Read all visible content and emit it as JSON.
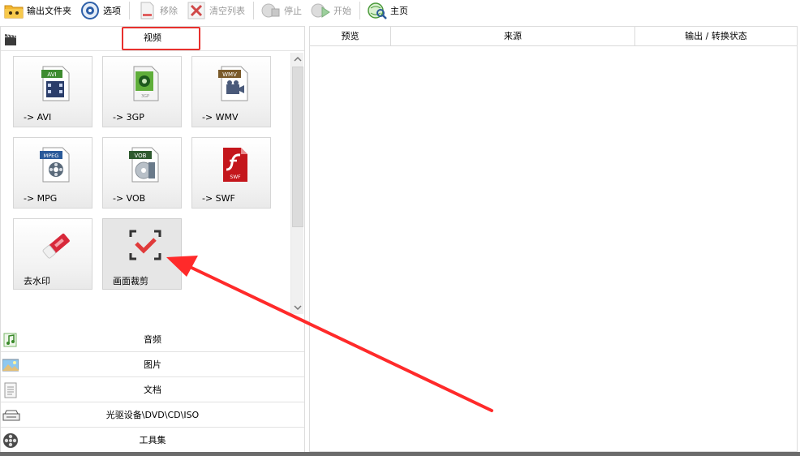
{
  "toolbar": {
    "output_folder": "输出文件夹",
    "options": "选项",
    "remove": "移除",
    "clear_list": "清空列表",
    "stop": "停止",
    "start": "开始",
    "home": "主页"
  },
  "categories": {
    "video": "视频",
    "audio": "音频",
    "image": "图片",
    "document": "文档",
    "disc": "光驱设备\\DVD\\CD\\ISO",
    "tools": "工具集"
  },
  "video_tiles": [
    {
      "label": "-> AVI",
      "badge": "AVI",
      "icon": "avi-file-icon"
    },
    {
      "label": "-> 3GP",
      "badge": "3GP",
      "icon": "3gp-file-icon"
    },
    {
      "label": "-> WMV",
      "badge": "WMV",
      "icon": "wmv-file-icon"
    },
    {
      "label": "-> MPG",
      "badge": "MPEG",
      "icon": "mpeg-file-icon"
    },
    {
      "label": "-> VOB",
      "badge": "VOB",
      "icon": "vob-file-icon"
    },
    {
      "label": "-> SWF",
      "badge": "SWF",
      "icon": "swf-file-icon"
    },
    {
      "label": "去水印",
      "icon": "eraser-icon"
    },
    {
      "label": "画面裁剪",
      "icon": "crop-check-icon"
    }
  ],
  "columns": {
    "preview": "预览",
    "source": "来源",
    "output_status": "输出 / 转换状态"
  },
  "colors": {
    "highlight_red": "#e8302d",
    "avi_green": "#3d8b2f",
    "wmv_brown": "#7a5a2a",
    "mpeg_blue": "#2a5a9a",
    "swf_red": "#c4161c"
  }
}
